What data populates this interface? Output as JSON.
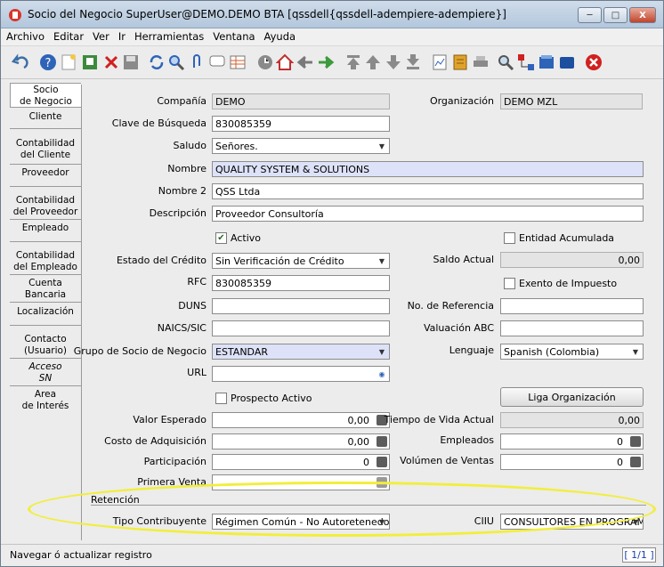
{
  "window": {
    "title": "Socio del Negocio  SuperUser@DEMO.DEMO BTA [qssdell{qssdell-adempiere-adempiere}]",
    "minimize": "─",
    "maximize": "□",
    "close": "X"
  },
  "menu": [
    "Archivo",
    "Editar",
    "Ver",
    "Ir",
    "Herramientas",
    "Ventana",
    "Ayuda"
  ],
  "toolbar_icons": [
    "undo-icon",
    "help-icon",
    "new-record-icon",
    "copy-icon",
    "delete-icon",
    "save-icon",
    "refresh-icon",
    "find-icon",
    "attachment-icon",
    "chat-icon",
    "grid-toggle-icon",
    "history-icon",
    "home-icon",
    "back-icon",
    "forward-icon",
    "first-record-icon",
    "previous-record-icon",
    "next-record-icon",
    "last-record-icon",
    "report-icon",
    "archive-icon",
    "print-icon",
    "zoom-across-icon",
    "workflow-icon",
    "request-icon",
    "product-info-icon",
    "exit-icon"
  ],
  "tabs": [
    {
      "label": "Socio\nde Negocio",
      "active": true
    },
    {
      "label": "Cliente"
    },
    {
      "label": "Contabilidad\ndel Cliente"
    },
    {
      "label": "Proveedor"
    },
    {
      "label": "Contabilidad\ndel Proveedor"
    },
    {
      "label": "Empleado"
    },
    {
      "label": "Contabilidad\ndel Empleado"
    },
    {
      "label": "Cuenta\nBancaria"
    },
    {
      "label": "Localización"
    },
    {
      "label": "Contacto\n(Usuario)"
    },
    {
      "label": "Acceso\nSN",
      "italic": true
    },
    {
      "label": "Area\nde Interés"
    }
  ],
  "form": {
    "compania_label": "Compañía",
    "compania": "DEMO",
    "organizacion_label": "Organización",
    "organizacion": "DEMO MZL",
    "clave_label": "Clave de Búsqueda",
    "clave": "830085359",
    "saludo_label": "Saludo",
    "saludo": "Señores.",
    "nombre_label": "Nombre",
    "nombre": "QUALITY SYSTEM & SOLUTIONS",
    "nombre2_label": "Nombre 2",
    "nombre2": "QSS Ltda",
    "descripcion_label": "Descripción",
    "descripcion": "Proveedor Consultoría",
    "activo_label": "Activo",
    "activo": true,
    "entidad_label": "Entidad Acumulada",
    "entidad": false,
    "estado_credito_label": "Estado del Crédito",
    "estado_credito": "Sin Verificación de Crédito",
    "saldo_label": "Saldo Actual",
    "saldo": "0,00",
    "rfc_label": "RFC",
    "rfc": "830085359",
    "exento_label": "Exento de Impuesto",
    "exento": false,
    "duns_label": "DUNS",
    "duns": "",
    "referencia_label": "No. de Referencia",
    "referencia": "",
    "naics_label": "NAICS/SIC",
    "naics": "",
    "valuacion_label": "Valuación ABC",
    "valuacion": "",
    "grupo_label": "Grupo de Socio de Negocio",
    "grupo": "ESTANDAR",
    "lenguaje_label": "Lenguaje",
    "lenguaje": "Spanish (Colombia)",
    "url_label": "URL",
    "url": "",
    "prospecto_label": "Prospecto Activo",
    "prospecto": false,
    "liga_button": "Liga Organización",
    "valor_esperado_label": "Valor Esperado",
    "valor_esperado": "0,00",
    "tiempo_vida_label": "Tiempo de Vida Actual",
    "tiempo_vida": "0,00",
    "costo_label": "Costo de Adquisición",
    "costo": "0,00",
    "empleados_label": "Empleados",
    "empleados": "0",
    "participacion_label": "Participación",
    "participacion": "0",
    "volumen_label": "Volúmen de Ventas",
    "volumen": "0",
    "primera_venta_label": "Primera Venta",
    "primera_venta": "",
    "retencion_section": "Retención",
    "tipo_contribuyente_label": "Tipo Contribuyente",
    "tipo_contribuyente": "Régimen Común - No Autoretenedor",
    "ciiu_label": "CIIU",
    "ciiu": "CONSULTORES EN PROGRAM..."
  },
  "status": {
    "message": "Navegar ó actualizar registro",
    "record": "[ 1/1 ]"
  },
  "colors": {
    "mandatory_bg": "#dde2f8",
    "highlight_ellipse": "#f2ee3a"
  }
}
